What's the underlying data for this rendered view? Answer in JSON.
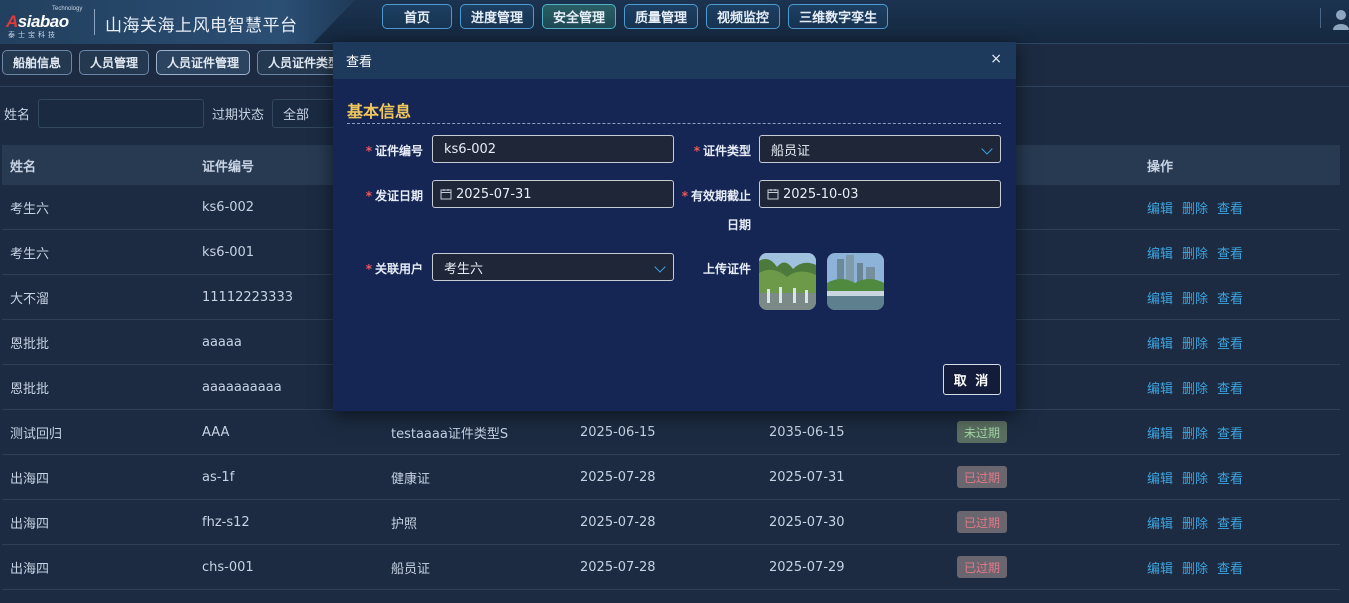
{
  "header": {
    "logo_text": "Asiabao",
    "logo_tm": "Technology",
    "logo_cn": "泰士宝科技",
    "app_title": "山海关海上风电智慧平台",
    "nav": [
      {
        "label": "首页"
      },
      {
        "label": "进度管理"
      },
      {
        "label": "安全管理"
      },
      {
        "label": "质量管理"
      },
      {
        "label": "视频监控"
      },
      {
        "label": "三维数字孪生"
      }
    ],
    "active_nav": "安全管理"
  },
  "tabs": [
    {
      "label": "船舶信息"
    },
    {
      "label": "人员管理"
    },
    {
      "label": "人员证件管理"
    },
    {
      "label": "人员证件类型"
    }
  ],
  "filter": {
    "name_label": "姓名",
    "expire_label": "过期状态",
    "expire_value": "全部"
  },
  "table": {
    "headers": [
      "姓名",
      "证件编号",
      "",
      "",
      "",
      "",
      "操作"
    ],
    "rows": [
      {
        "name": "考生六",
        "code": "ks6-002",
        "type": "",
        "issue": "",
        "expiry": "",
        "status": "",
        "status_kind": ""
      },
      {
        "name": "考生六",
        "code": "ks6-001",
        "type": "",
        "issue": "",
        "expiry": "",
        "status": "",
        "status_kind": ""
      },
      {
        "name": "大不溜",
        "code": "11112223333",
        "type": "",
        "issue": "",
        "expiry": "",
        "status": "",
        "status_kind": ""
      },
      {
        "name": "恩批批",
        "code": "aaaaa",
        "type": "",
        "issue": "",
        "expiry": "",
        "status": "",
        "status_kind": ""
      },
      {
        "name": "恩批批",
        "code": "aaaaaaaaaa",
        "type": "",
        "issue": "",
        "expiry": "",
        "status": "",
        "status_kind": ""
      },
      {
        "name": "测试回归",
        "code": "AAA",
        "type": "testaaaa证件类型S",
        "issue": "2025-06-15",
        "expiry": "2035-06-15",
        "status": "未过期",
        "status_kind": "ok"
      },
      {
        "name": "出海四",
        "code": "as-1f",
        "type": "健康证",
        "issue": "2025-07-28",
        "expiry": "2025-07-31",
        "status": "已过期",
        "status_kind": "exp"
      },
      {
        "name": "出海四",
        "code": "fhz-s12",
        "type": "护照",
        "issue": "2025-07-28",
        "expiry": "2025-07-30",
        "status": "已过期",
        "status_kind": "exp"
      },
      {
        "name": "出海四",
        "code": "chs-001",
        "type": "船员证",
        "issue": "2025-07-28",
        "expiry": "2025-07-29",
        "status": "已过期",
        "status_kind": "exp"
      }
    ],
    "ops": {
      "edit": "编辑",
      "delete": "删除",
      "view": "查看"
    }
  },
  "modal": {
    "title": "查看",
    "close": "×",
    "section": "基本信息",
    "fields": {
      "cert_no_label": "证件编号",
      "cert_no_value": "ks6-002",
      "cert_type_label": "证件类型",
      "cert_type_value": "船员证",
      "issue_label": "发证日期",
      "issue_value": "2025-07-31",
      "valid_label_1": "有效期截止",
      "valid_label_2": "日期",
      "valid_value": "2025-10-03",
      "user_label": "关联用户",
      "user_value": "考生六",
      "upload_label": "上传证件"
    },
    "cancel": "取 消"
  },
  "colors": {
    "accent": "#3ea4e0",
    "section": "#f0c75d",
    "required": "#f05a5a",
    "ok_badge": "#a2d7a3",
    "expired_badge": "#e07a86"
  }
}
